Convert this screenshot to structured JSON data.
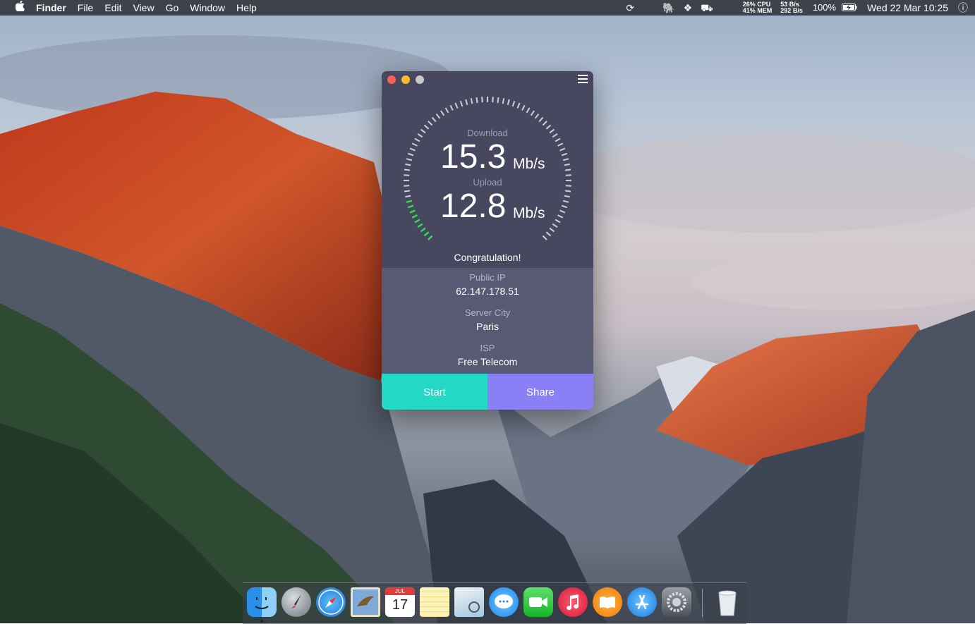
{
  "menubar": {
    "apple": "",
    "app_name": "Finder",
    "menus": [
      "File",
      "Edit",
      "View",
      "Go",
      "Window",
      "Help"
    ],
    "cpu": "26% CPU",
    "mem": "41% MEM",
    "net_up": "53 B/s",
    "net_down": "292 B/s",
    "battery": "100%",
    "clock": "Wed 22 Mar 10:25"
  },
  "app": {
    "download_label": "Download",
    "download_value": "15.3",
    "download_unit": "Mb/s",
    "upload_label": "Upload",
    "upload_value": "12.8",
    "upload_unit": "Mb/s",
    "status": "Congratulation!",
    "progress_fraction": 0.12,
    "public_ip_label": "Public IP",
    "public_ip": "62.147.178.51",
    "server_city_label": "Server City",
    "server_city": "Paris",
    "isp_label": "ISP",
    "isp": "Free Telecom",
    "start_label": "Start",
    "share_label": "Share",
    "gauge_color": "#e6e6ee",
    "progress_color": "#2fe04f"
  },
  "dock": {
    "items": [
      "finder-icon",
      "launchpad-icon",
      "safari-icon",
      "mail-icon",
      "calendar-icon",
      "notes-icon",
      "preview-icon",
      "messages-icon",
      "facetime-icon",
      "itunes-icon",
      "ibooks-icon",
      "app-store-icon",
      "system-preferences-icon",
      "trash-icon"
    ],
    "calendar_month": "JUL",
    "calendar_day": "17"
  }
}
